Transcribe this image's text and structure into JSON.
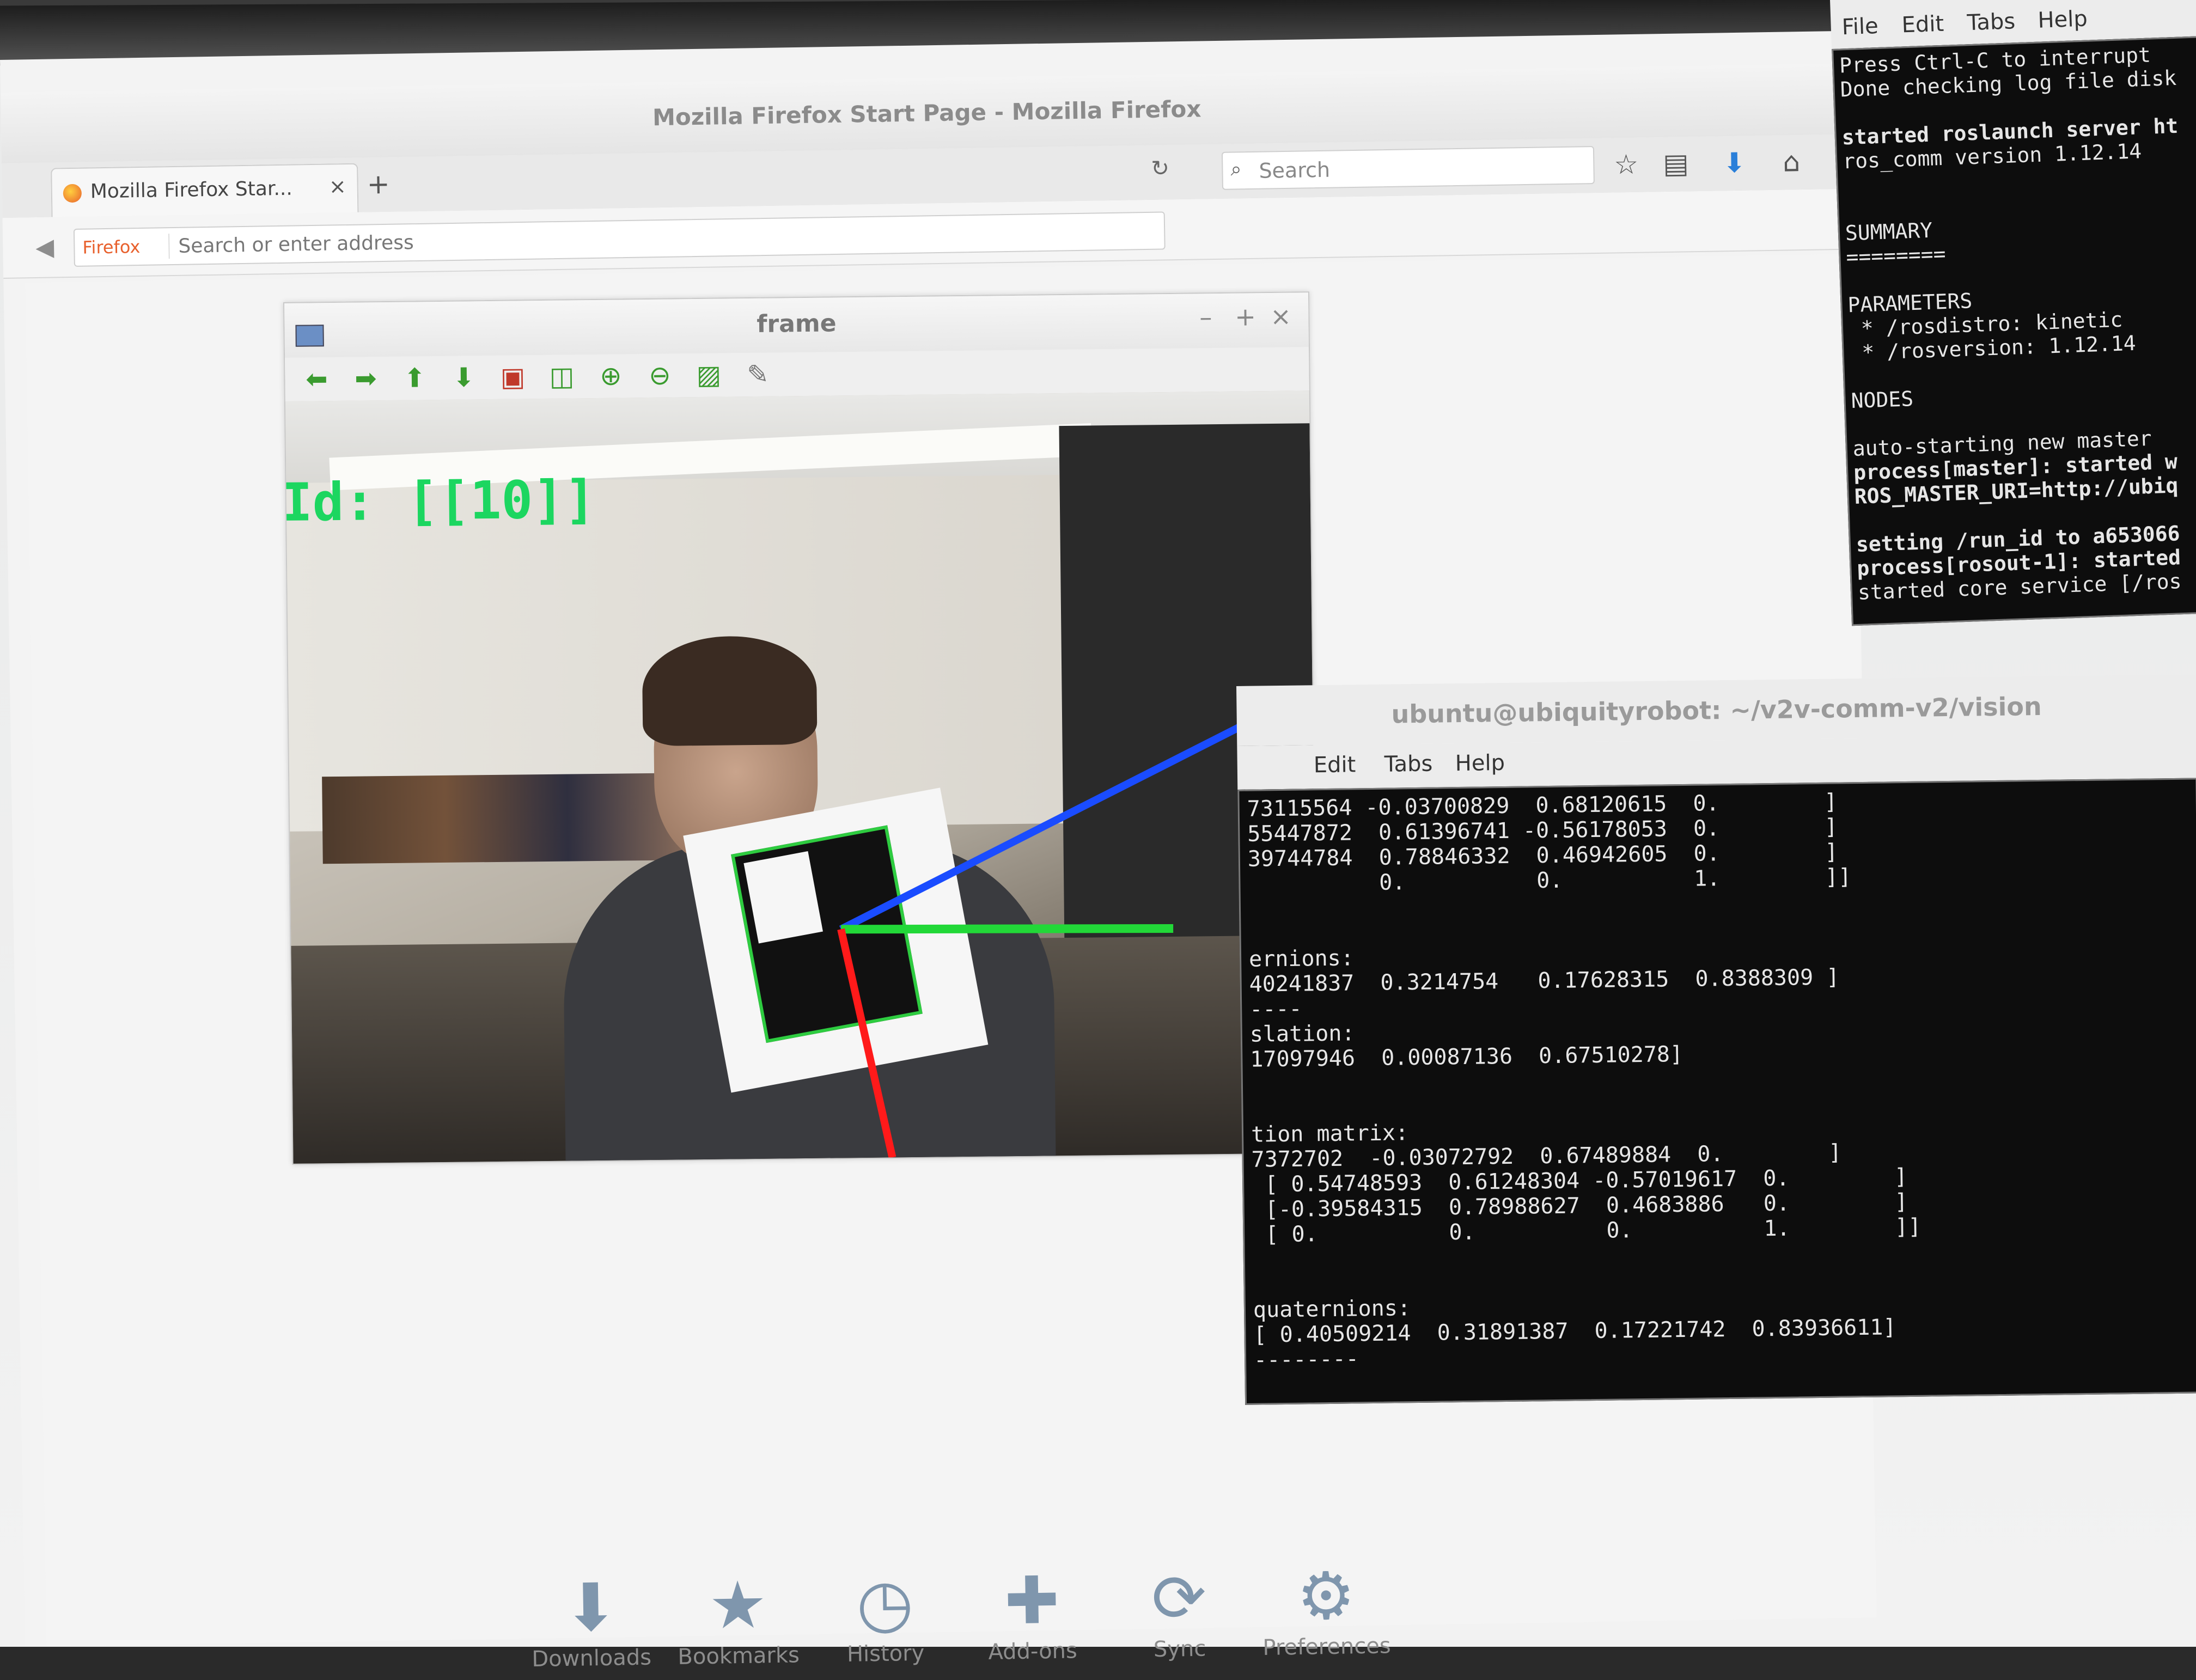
{
  "firefox": {
    "window_title": "Mozilla Firefox Start Page - Mozilla Firefox",
    "tab_label": "Mozilla Firefox Star...",
    "tab_close": "×",
    "new_tab": "+",
    "identity_label": "Firefox",
    "url_placeholder": "Search or enter address",
    "search_placeholder": "Search",
    "bottom_items": [
      "Downloads",
      "Bookmarks",
      "History",
      "Add-ons",
      "Sync",
      "Preferences"
    ]
  },
  "frame_window": {
    "title": "frame",
    "id_overlay": "Id: [[10]]"
  },
  "terminal_vision": {
    "title": "ubuntu@ubiquityrobot: ~/v2v-comm-v2/vision",
    "menu": [
      "Edit",
      "Tabs",
      "Help"
    ],
    "lines": [
      "73115564 -0.03700829  0.68120615  0.        ]",
      "55447872  0.61396741 -0.56178053  0.        ]",
      "39744784  0.78846332  0.46942605  0.        ]",
      "          0.          0.          1.        ]]",
      "",
      "",
      "ernions:",
      "40241837  0.3214754   0.17628315  0.8388309 ]",
      "----",
      "slation:",
      "17097946  0.00087136  0.67510278]",
      "",
      "",
      "tion matrix:",
      "7372702  -0.03072792  0.67489884  0.        ]",
      " [ 0.54748593  0.61248304 -0.57019617  0.        ]",
      " [-0.39584315  0.78988627  0.4683886   0.        ]",
      " [ 0.          0.          0.          1.        ]]",
      "",
      "",
      "quaternions:",
      "[ 0.40509214  0.31891387  0.17221742  0.83936611]",
      "--------"
    ]
  },
  "terminal_roscore": {
    "menu": [
      "File",
      "Edit",
      "Tabs",
      "Help"
    ],
    "lines": [
      {
        "text": "Press Ctrl-C to interrupt",
        "bold": false
      },
      {
        "text": "Done checking log file disk",
        "bold": false
      },
      {
        "text": "",
        "bold": false
      },
      {
        "text": "started roslaunch server ht",
        "bold": true
      },
      {
        "text": "ros_comm version 1.12.14",
        "bold": false
      },
      {
        "text": "",
        "bold": false
      },
      {
        "text": "",
        "bold": false
      },
      {
        "text": "SUMMARY",
        "bold": false
      },
      {
        "text": "========",
        "bold": false
      },
      {
        "text": "",
        "bold": false
      },
      {
        "text": "PARAMETERS",
        "bold": false
      },
      {
        "text": " * /rosdistro: kinetic",
        "bold": false
      },
      {
        "text": " * /rosversion: 1.12.14",
        "bold": false
      },
      {
        "text": "",
        "bold": false
      },
      {
        "text": "NODES",
        "bold": false
      },
      {
        "text": "",
        "bold": false
      },
      {
        "text": "auto-starting new master",
        "bold": false
      },
      {
        "text": "process[master]: started w",
        "bold": true
      },
      {
        "text": "ROS_MASTER_URI=http://ubiq",
        "bold": true
      },
      {
        "text": "",
        "bold": false
      },
      {
        "text": "setting /run_id to a653066",
        "bold": true
      },
      {
        "text": "process[rosout-1]: started",
        "bold": true
      },
      {
        "text": "started core service [/ros",
        "bold": false
      }
    ]
  },
  "colors": {
    "id_green": "#1cd660",
    "axis_blue": "#1a4cff",
    "axis_green": "#22d838",
    "axis_red": "#ff1a1a"
  }
}
